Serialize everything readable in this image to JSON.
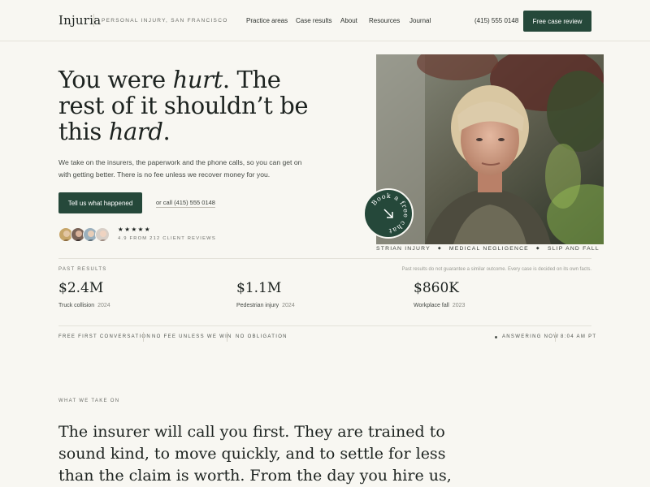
{
  "header": {
    "logo": "Injuria",
    "tagline": "PERSONAL INJURY, SAN FRANCISCO",
    "nav": [
      "Practice areas",
      "Case results",
      "About",
      "Resources",
      "Journal"
    ],
    "phone": "(415) 555 0148",
    "cta": "Free case review"
  },
  "hero": {
    "title_1": "You were ",
    "title_em1": "hurt",
    "title_2": ". The rest of it shouldn’t be this ",
    "title_em2": "hard",
    "title_3": ".",
    "description": "We take on the insurers, the paperwork and the phone calls, so you can get on with getting better. There is no fee unless we recover money for you.",
    "primary_button": "Tell us what happened",
    "call_link": "or call (415) 555 0148",
    "stars": "★★★★★",
    "rating": "4.9 FROM 212 CLIENT REVIEWS"
  },
  "badge": {
    "text": "Book a free chat"
  },
  "ticker": [
    "STRIAN INJURY",
    "MEDICAL NEGLIGENCE",
    "SLIP AND FALL"
  ],
  "results": {
    "label": "PAST RESULTS",
    "disclaimer": "Past results do not guarantee a similar outcome. Every case is decided on its own facts.",
    "items": [
      {
        "amount": "$2.4M",
        "case": "Truck collision",
        "year": "2024"
      },
      {
        "amount": "$1.1M",
        "case": "Pedestrian injury",
        "year": "2024"
      },
      {
        "amount": "$860K",
        "case": "Workplace fall",
        "year": "2023"
      }
    ]
  },
  "assurances": [
    "FREE FIRST CONVERSATION",
    "NO FEE UNLESS WE WIN",
    "NO OBLIGATION"
  ],
  "status": {
    "answering": "ANSWERING NOW",
    "time": "8:04 AM PT"
  },
  "intro": {
    "label": "WHAT WE TAKE ON",
    "text": "The insurer will call you first. They are trained to sound kind, to move quickly, and to settle for less than the claim is worth. From the day you hire us, they call here instead."
  },
  "colors": {
    "accent": "#25483a",
    "background": "#f8f7f2"
  }
}
